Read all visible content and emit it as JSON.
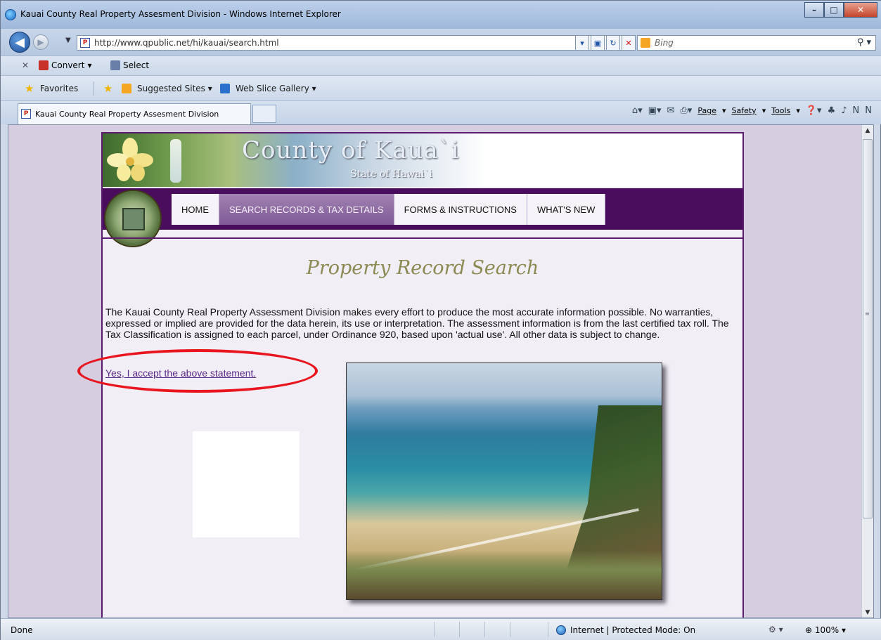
{
  "window": {
    "title": "Kauai County Real Property Assesment Division - Windows Internet Explorer",
    "minimize": "–",
    "maximize": "□",
    "close": "✕"
  },
  "address_bar": {
    "url": "http://www.qpublic.net/hi/kauai/search.html",
    "search_placeholder": "Bing"
  },
  "command_toolbar": {
    "close": "✕",
    "convert_label": "Convert",
    "select_label": "Select"
  },
  "favorites_bar": {
    "favorites_label": "Favorites",
    "suggested_sites_label": "Suggested Sites ▾",
    "web_slice_gallery_label": "Web Slice Gallery ▾"
  },
  "tabs": {
    "active_tab_label": "Kauai County Real Property Assesment Division"
  },
  "command_bar": {
    "page_label": "Page",
    "safety_label": "Safety",
    "tools_label": "Tools"
  },
  "site": {
    "banner_title": "County of Kaua`i",
    "banner_subtitle": "State of Hawai`i",
    "nav": [
      {
        "label": "HOME",
        "active": false
      },
      {
        "label": "SEARCH RECORDS & TAX DETAILS",
        "active": true
      },
      {
        "label": "FORMS & INSTRUCTIONS",
        "active": false
      },
      {
        "label": "WHAT'S NEW",
        "active": false
      }
    ],
    "page_title": "Property Record Search",
    "disclaimer": "The Kauai County Real Property Assessment Division makes every effort to produce the most accurate information possible. No warranties, expressed or implied are provided for the data herein, its use or interpretation. The assessment information is from the last certified tax roll. The Tax Classification is assigned to each parcel, under Ordinance 920, based upon 'actual use'. All other data is subject to change.",
    "accept_link": "Yes, I accept the above statement."
  },
  "status_bar": {
    "status": "Done",
    "zone": "Internet | Protected Mode: On",
    "zoom": "100%"
  },
  "colors": {
    "nav_background": "#4a0d5e",
    "nav_active": "#8c68a3",
    "title_color": "#8b8a52",
    "link_color": "#5a2a87",
    "annotation_red": "#e8141e"
  }
}
